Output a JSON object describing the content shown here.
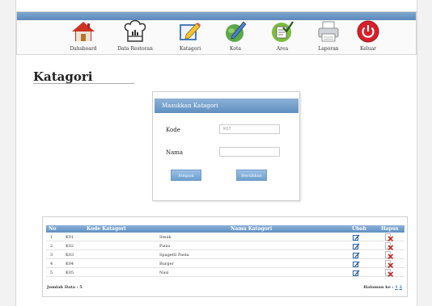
{
  "nav": {
    "items": [
      {
        "label": "Dahsboard"
      },
      {
        "label": "Data Restoran"
      },
      {
        "label": "Katagori"
      },
      {
        "label": "Kota"
      },
      {
        "label": "Area"
      },
      {
        "label": "Laporan"
      },
      {
        "label": "Keluar"
      }
    ]
  },
  "page": {
    "title": "Katagori"
  },
  "form": {
    "header": "Masukkan Katagori",
    "kode_label": "Kode",
    "kode_value": "K07",
    "nama_label": "Nama",
    "nama_value": "",
    "simpan_label": "Simpan",
    "bersihkan_label": "Bersihkan"
  },
  "table": {
    "columns": [
      "No",
      "Kode Katagori",
      "Nama Katagori",
      "Ubah",
      "Hapus"
    ],
    "rows": [
      {
        "no": "1",
        "kode": "K01",
        "nama": "Steak"
      },
      {
        "no": "2",
        "kode": "K02",
        "nama": "Pizza"
      },
      {
        "no": "3",
        "kode": "K03",
        "nama": "Spagetti Pasta"
      },
      {
        "no": "4",
        "kode": "K04",
        "nama": "Burger"
      },
      {
        "no": "5",
        "kode": "K05",
        "nama": "Nasi"
      }
    ],
    "footer_left": "Jumlah Data : 5",
    "footer_right_label": "Halaman ke :",
    "pages": [
      "1",
      "2"
    ]
  },
  "colors": {
    "accent": "#6b96c6",
    "delete": "#cc2222"
  },
  "icons": [
    "home-icon",
    "chef-hat-icon",
    "edit-icon",
    "pencil-icon",
    "checklist-icon",
    "printer-icon",
    "power-icon"
  ]
}
